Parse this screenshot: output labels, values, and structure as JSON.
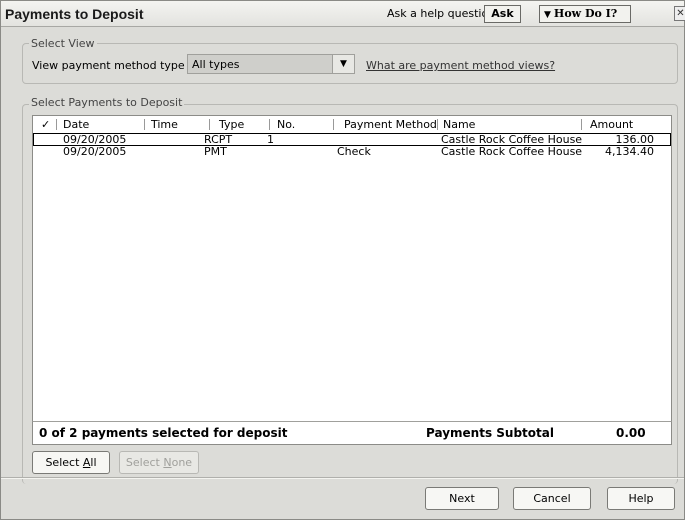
{
  "window": {
    "title": "Payments to Deposit",
    "help_label": "Ask a help question",
    "ask_label": "Ask",
    "how_do_i_label": "How Do I?"
  },
  "select_view": {
    "legend": "Select View",
    "label": "View payment method type",
    "value": "All types",
    "link": "What are payment method views?"
  },
  "payments": {
    "legend": "Select Payments to Deposit",
    "columns": {
      "check": "✓",
      "date": "Date",
      "time": "Time",
      "type": "Type",
      "no": "No.",
      "method": "Payment Method",
      "name": "Name",
      "amount": "Amount"
    },
    "rows": [
      {
        "date": "09/20/2005",
        "time": "",
        "type": "RCPT",
        "no": "1",
        "method": "",
        "name": "Castle Rock Coffee House",
        "amount": "136.00"
      },
      {
        "date": "09/20/2005",
        "time": "",
        "type": "PMT",
        "no": "",
        "method": "Check",
        "name": "Castle Rock Coffee House",
        "amount": "4,134.40"
      }
    ],
    "selected_text": "0 of 2 payments selected for deposit",
    "subtotal_label": "Payments Subtotal",
    "subtotal_value": "0.00"
  },
  "buttons": {
    "select_all": {
      "pre": "Select ",
      "ul": "A",
      "post": "ll"
    },
    "select_none": {
      "pre": "Select ",
      "ul": "N",
      "post": "one"
    },
    "next": "Next",
    "cancel": "Cancel",
    "help": "Help"
  }
}
